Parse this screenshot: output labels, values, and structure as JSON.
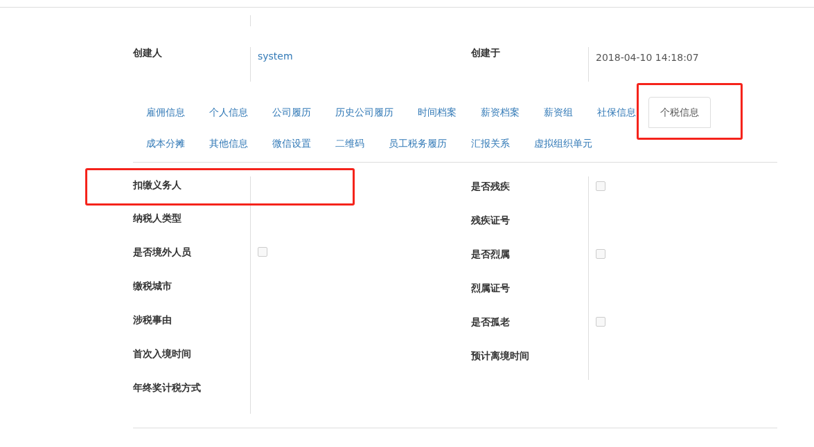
{
  "header_fields": [
    {
      "label": "创建人",
      "value": "system",
      "kind": "link"
    },
    {
      "label": "创建于",
      "value": "2018-04-10 14:18:07",
      "kind": "text"
    }
  ],
  "tabs": [
    {
      "label": "雇佣信息",
      "selected": false,
      "highlighted": false
    },
    {
      "label": "个人信息",
      "selected": false,
      "highlighted": false
    },
    {
      "label": "公司履历",
      "selected": false,
      "highlighted": false
    },
    {
      "label": "历史公司履历",
      "selected": false,
      "highlighted": false
    },
    {
      "label": "时间档案",
      "selected": false,
      "highlighted": false
    },
    {
      "label": "薪资档案",
      "selected": false,
      "highlighted": false
    },
    {
      "label": "薪资组",
      "selected": false,
      "highlighted": false
    },
    {
      "label": "社保信息",
      "selected": false,
      "highlighted": false
    },
    {
      "label": "个税信息",
      "selected": true,
      "highlighted": true
    },
    {
      "label": "成本分摊",
      "selected": false,
      "highlighted": false
    },
    {
      "label": "其他信息",
      "selected": false,
      "highlighted": false
    },
    {
      "label": "微信设置",
      "selected": false,
      "highlighted": false
    },
    {
      "label": "二维码",
      "selected": false,
      "highlighted": false
    },
    {
      "label": "员工税务履历",
      "selected": false,
      "highlighted": false
    },
    {
      "label": "汇报关系",
      "selected": false,
      "highlighted": false
    },
    {
      "label": "虚拟组织单元",
      "selected": false,
      "highlighted": false
    }
  ],
  "left_fields": [
    {
      "label": "扣缴义务人",
      "kind": "text",
      "highlighted": true
    },
    {
      "label": "纳税人类型",
      "kind": "text",
      "highlighted": false
    },
    {
      "label": "是否境外人员",
      "kind": "checkbox",
      "checked": false,
      "highlighted": false
    },
    {
      "label": "缴税城市",
      "kind": "text",
      "highlighted": false
    },
    {
      "label": "涉税事由",
      "kind": "text",
      "highlighted": false
    },
    {
      "label": "首次入境时间",
      "kind": "text",
      "highlighted": false
    },
    {
      "label": "年终奖计税方式",
      "kind": "text",
      "highlighted": false
    }
  ],
  "right_fields": [
    {
      "label": "是否残疾",
      "kind": "checkbox",
      "checked": false,
      "highlighted": false
    },
    {
      "label": "残疾证号",
      "kind": "text",
      "highlighted": false
    },
    {
      "label": "是否烈属",
      "kind": "checkbox",
      "checked": false,
      "highlighted": false
    },
    {
      "label": "烈属证号",
      "kind": "text",
      "highlighted": false
    },
    {
      "label": "是否孤老",
      "kind": "checkbox",
      "checked": false,
      "highlighted": false
    },
    {
      "label": "预计离境时间",
      "kind": "text",
      "highlighted": false
    }
  ]
}
